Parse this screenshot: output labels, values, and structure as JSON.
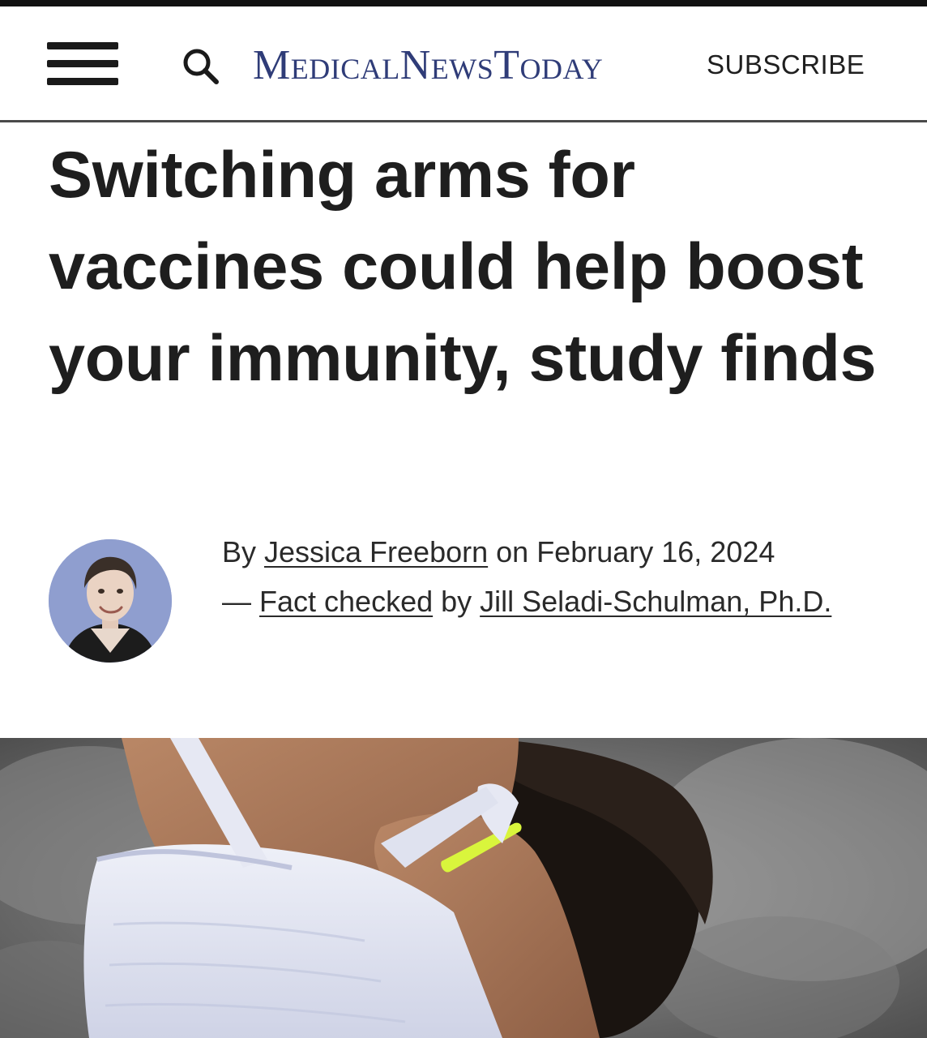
{
  "header": {
    "logo_text": "MedicalNewsToday",
    "subscribe_label": "SUBSCRIBE",
    "menu_icon": "hamburger-menu-icon",
    "search_icon": "search-icon"
  },
  "article": {
    "headline": "Switching arms for vaccines could help boost your immunity, study finds",
    "byline": {
      "by_prefix": "By ",
      "author": "Jessica Freeborn",
      "date_prefix": " on ",
      "date": "February 16, 2024",
      "dash": "— ",
      "fact_checked_label": "Fact checked",
      "by_mid": " by ",
      "fact_checker": "Jill Seladi-Schulman, Ph.D."
    }
  },
  "colors": {
    "brand_blue": "#2f3c78",
    "text_dark": "#1e1e1e",
    "bandage_yellow": "#d9f53c",
    "avatar_background": "#8f9ecf"
  }
}
